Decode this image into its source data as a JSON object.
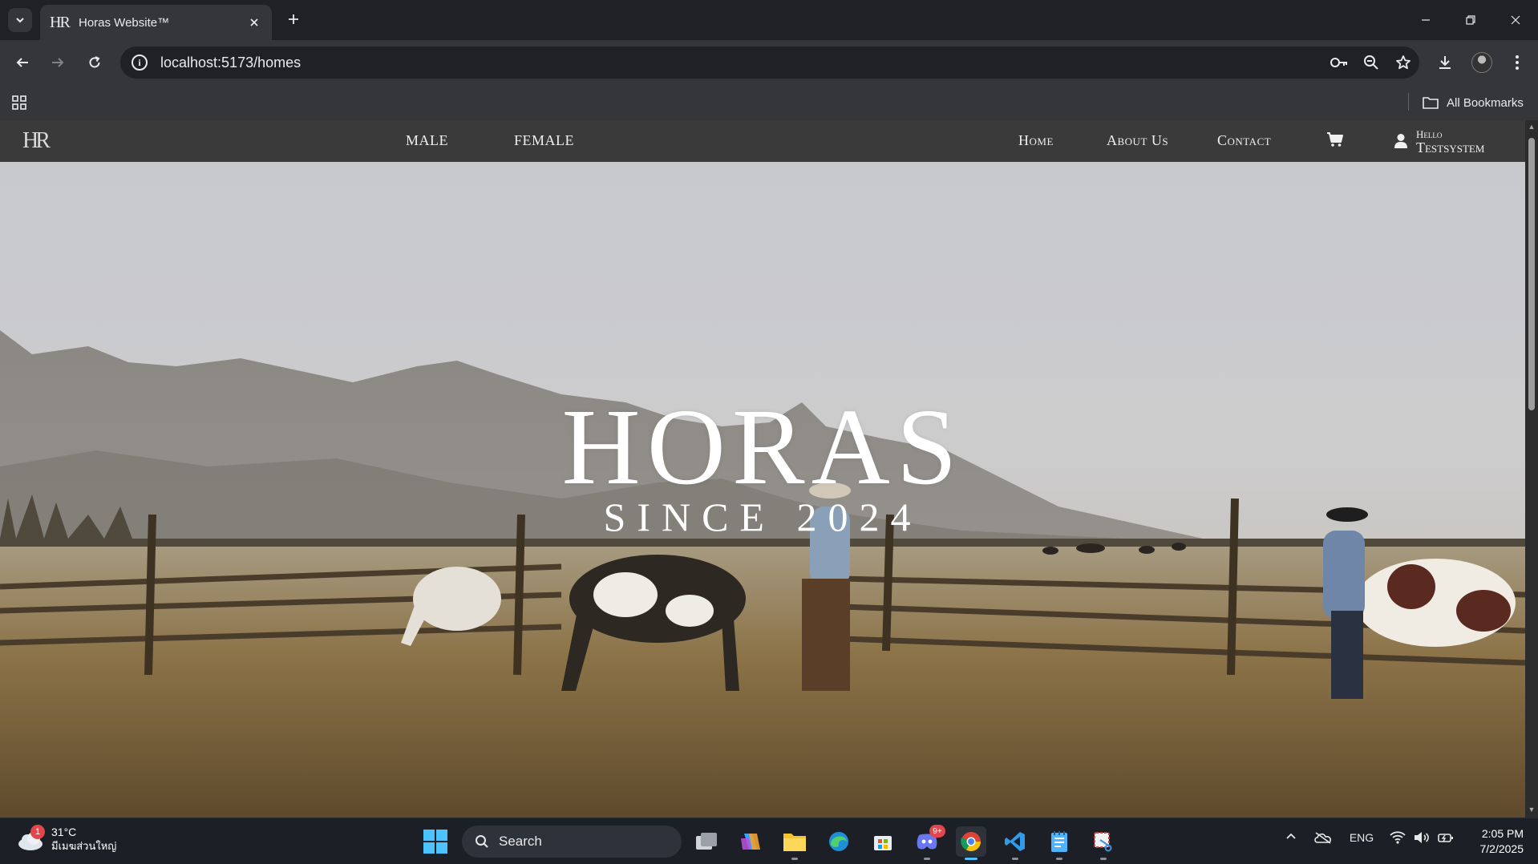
{
  "browser": {
    "tab_title": "Horas Website™",
    "tab_favicon": "HR",
    "url": "localhost:5173/homes",
    "bookmarks_label": "All Bookmarks"
  },
  "site": {
    "logo": "HR",
    "nav_left": [
      "MALE",
      "FEMALE"
    ],
    "nav_right": [
      "Home",
      "About Us",
      "Contact"
    ],
    "greeting": "Hello",
    "username": "Testsystem"
  },
  "hero": {
    "title": "HORAS",
    "subtitle": "SINCE 2024"
  },
  "taskbar": {
    "temperature": "31°C",
    "location": "มีเมฆส่วนใหญ่",
    "weather_badge": "1",
    "search_label": "Search",
    "discord_badge": "9+",
    "language": "ENG",
    "time": "2:05 PM",
    "date": "7/2/2025"
  },
  "colors": {
    "chrome_dark": "#202124",
    "chrome_toolbar": "#35363a",
    "site_nav": "#3a3a3a",
    "taskbar": "#1c2026",
    "accent": "#4cc2ff"
  }
}
